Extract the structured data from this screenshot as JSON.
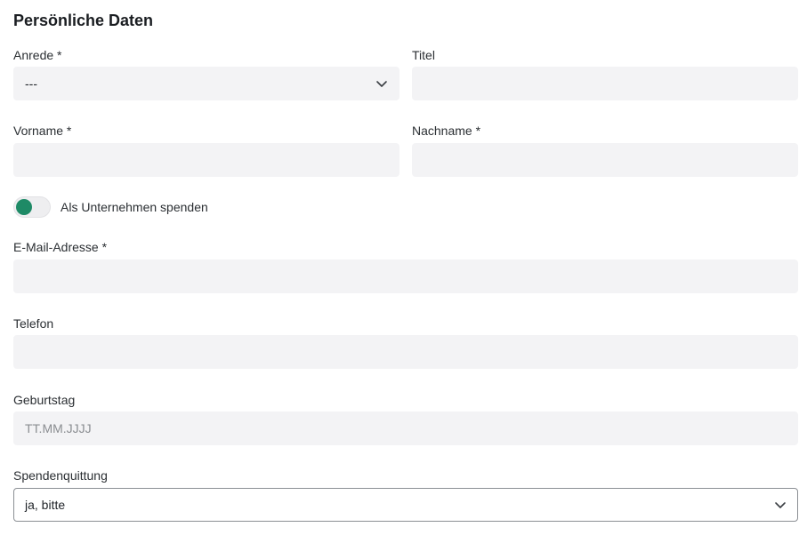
{
  "section": {
    "title": "Persönliche Daten"
  },
  "anrede": {
    "label": "Anrede *",
    "value": "---",
    "icon": "chevron-down-icon"
  },
  "titel": {
    "label": "Titel",
    "value": ""
  },
  "vorname": {
    "label": "Vorname *",
    "value": ""
  },
  "nachname": {
    "label": "Nachname *",
    "value": ""
  },
  "company_toggle": {
    "label": "Als Unternehmen spenden",
    "state": "on",
    "accent_color": "#1e8a66"
  },
  "email": {
    "label": "E-Mail-Adresse *",
    "value": ""
  },
  "telefon": {
    "label": "Telefon",
    "value": ""
  },
  "geburtstag": {
    "label": "Geburtstag",
    "placeholder": "TT.MM.JJJJ",
    "value": ""
  },
  "spendenquittung": {
    "label": "Spendenquittung",
    "value": "ja, bitte",
    "icon": "chevron-down-icon"
  }
}
